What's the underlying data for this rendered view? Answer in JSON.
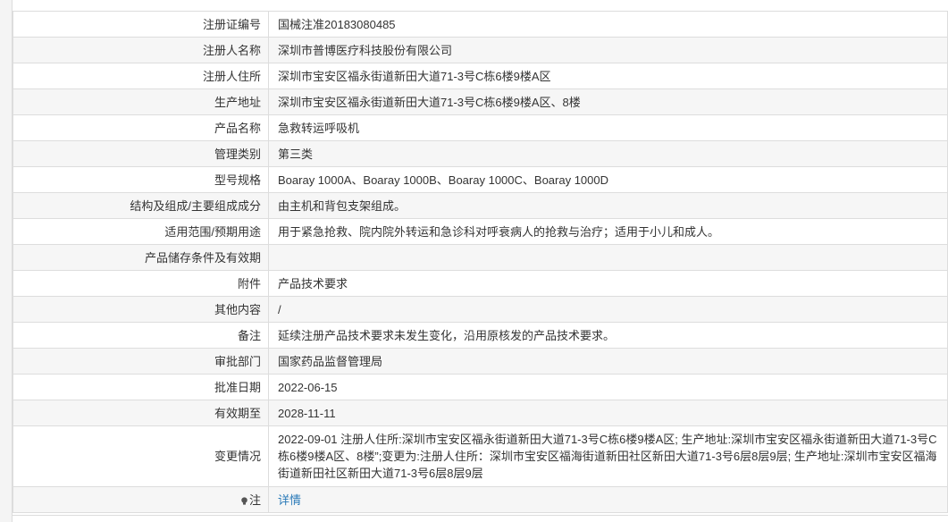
{
  "rows": [
    {
      "label": "注册证编号",
      "value": "国械注准20183080485"
    },
    {
      "label": "注册人名称",
      "value": "深圳市普博医疗科技股份有限公司"
    },
    {
      "label": "注册人住所",
      "value": "深圳市宝安区福永街道新田大道71-3号C栋6楼9楼A区"
    },
    {
      "label": "生产地址",
      "value": "深圳市宝安区福永街道新田大道71-3号C栋6楼9楼A区、8楼"
    },
    {
      "label": "产品名称",
      "value": "急救转运呼吸机"
    },
    {
      "label": "管理类别",
      "value": "第三类"
    },
    {
      "label": "型号规格",
      "value": "Boaray 1000A、Boaray 1000B、Boaray 1000C、Boaray 1000D"
    },
    {
      "label": "结构及组成/主要组成成分",
      "value": "由主机和背包支架组成。"
    },
    {
      "label": "适用范围/预期用途",
      "value": "用于紧急抢救、院内院外转运和急诊科对呼衰病人的抢救与治疗；适用于小儿和成人。"
    },
    {
      "label": "产品储存条件及有效期",
      "value": ""
    },
    {
      "label": "附件",
      "value": "产品技术要求"
    },
    {
      "label": "其他内容",
      "value": "/"
    },
    {
      "label": "备注",
      "value": "延续注册产品技术要求未发生变化，沿用原核发的产品技术要求。"
    },
    {
      "label": "审批部门",
      "value": "国家药品监督管理局"
    },
    {
      "label": "批准日期",
      "value": "2022-06-15"
    },
    {
      "label": "有效期至",
      "value": "2028-11-11"
    },
    {
      "label": "变更情况",
      "value": "2022-09-01 注册人住所:深圳市宝安区福永街道新田大道71-3号C栋6楼9楼A区; 生产地址:深圳市宝安区福永街道新田大道71-3号C栋6楼9楼A区、8楼”;变更为:注册人住所：深圳市宝安区福海街道新田社区新田大道71-3号6层8层9层; 生产地址:深圳市宝安区福海街道新田社区新田大道71-3号6层8层9层"
    }
  ],
  "note": {
    "label": "注",
    "link_text": "详情",
    "icon": "lightbulb-icon"
  }
}
